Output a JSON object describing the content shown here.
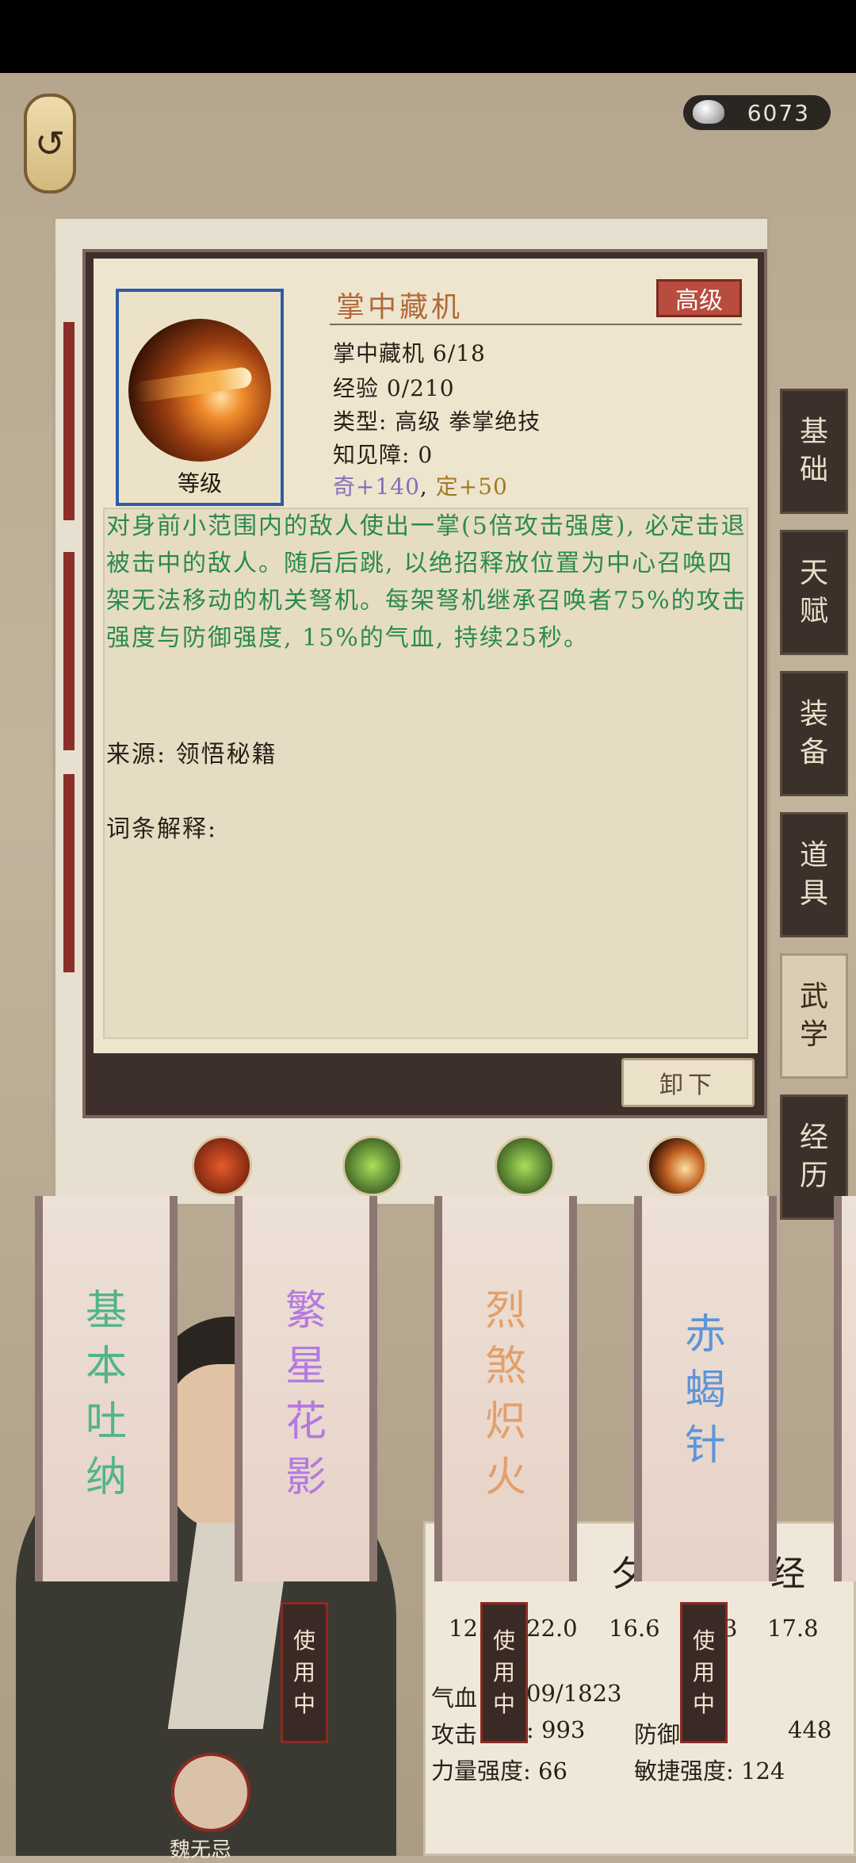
{
  "currency": {
    "value": "6073"
  },
  "side_tabs": [
    {
      "label": "基\n础",
      "active": false
    },
    {
      "label": "天\n赋",
      "active": false
    },
    {
      "label": "装\n备",
      "active": false
    },
    {
      "label": "道\n具",
      "active": false
    },
    {
      "label": "武\n学",
      "active": true
    },
    {
      "label": "经\n历",
      "active": false
    }
  ],
  "modal": {
    "icon_label": "等级",
    "skill_name": "掌中藏机",
    "grade": "高级",
    "level": "掌中藏机 6/18",
    "exp": "经验 0/210",
    "type": "类型: 高级 拳掌绝技",
    "barrier": "知见障: 0",
    "bonus_qi": "奇+140",
    "bonus_sep": ",",
    "bonus_ding": "定+50",
    "description": "对身前小范围内的敌人使出一掌(5倍攻击强度), 必定击退被击中的敌人。随后后跳, 以绝招释放位置为中心召唤四架无法移动的机关弩机。每架弩机继承召唤者75%的攻击强度与防御强度, 15%的气血, 持续25秒。",
    "source": "来源: 领悟秘籍",
    "terms": "词条解释:",
    "unequip": "卸下"
  },
  "scrolls": [
    {
      "text": "基\n本\n吐\n纳",
      "color": "#52b48a"
    },
    {
      "text": "繁\n星\n花\n影",
      "color": "#b47ae0"
    },
    {
      "text": "烈\n煞\n炽\n火",
      "color": "#e2a06a"
    },
    {
      "text": "赤\n蝎\n针",
      "color": "#5d95d8"
    }
  ],
  "in_use_tags": [
    "使\n用\n中",
    "使\n用\n中",
    "使\n用\n中"
  ],
  "stats": {
    "title_left": "夕",
    "title_right": "经",
    "row1": [
      "12.",
      "22.0",
      "16.6",
      "3",
      "17.8"
    ],
    "hp": "气血",
    "hp_val": "09/1823",
    "attack": "攻击",
    "attack_val": ": 993",
    "defense": "防御",
    "defense_val": "448",
    "str": "力量强度: 66",
    "agi": "敏捷强度: 124"
  },
  "character": {
    "name": "魏无忌"
  }
}
